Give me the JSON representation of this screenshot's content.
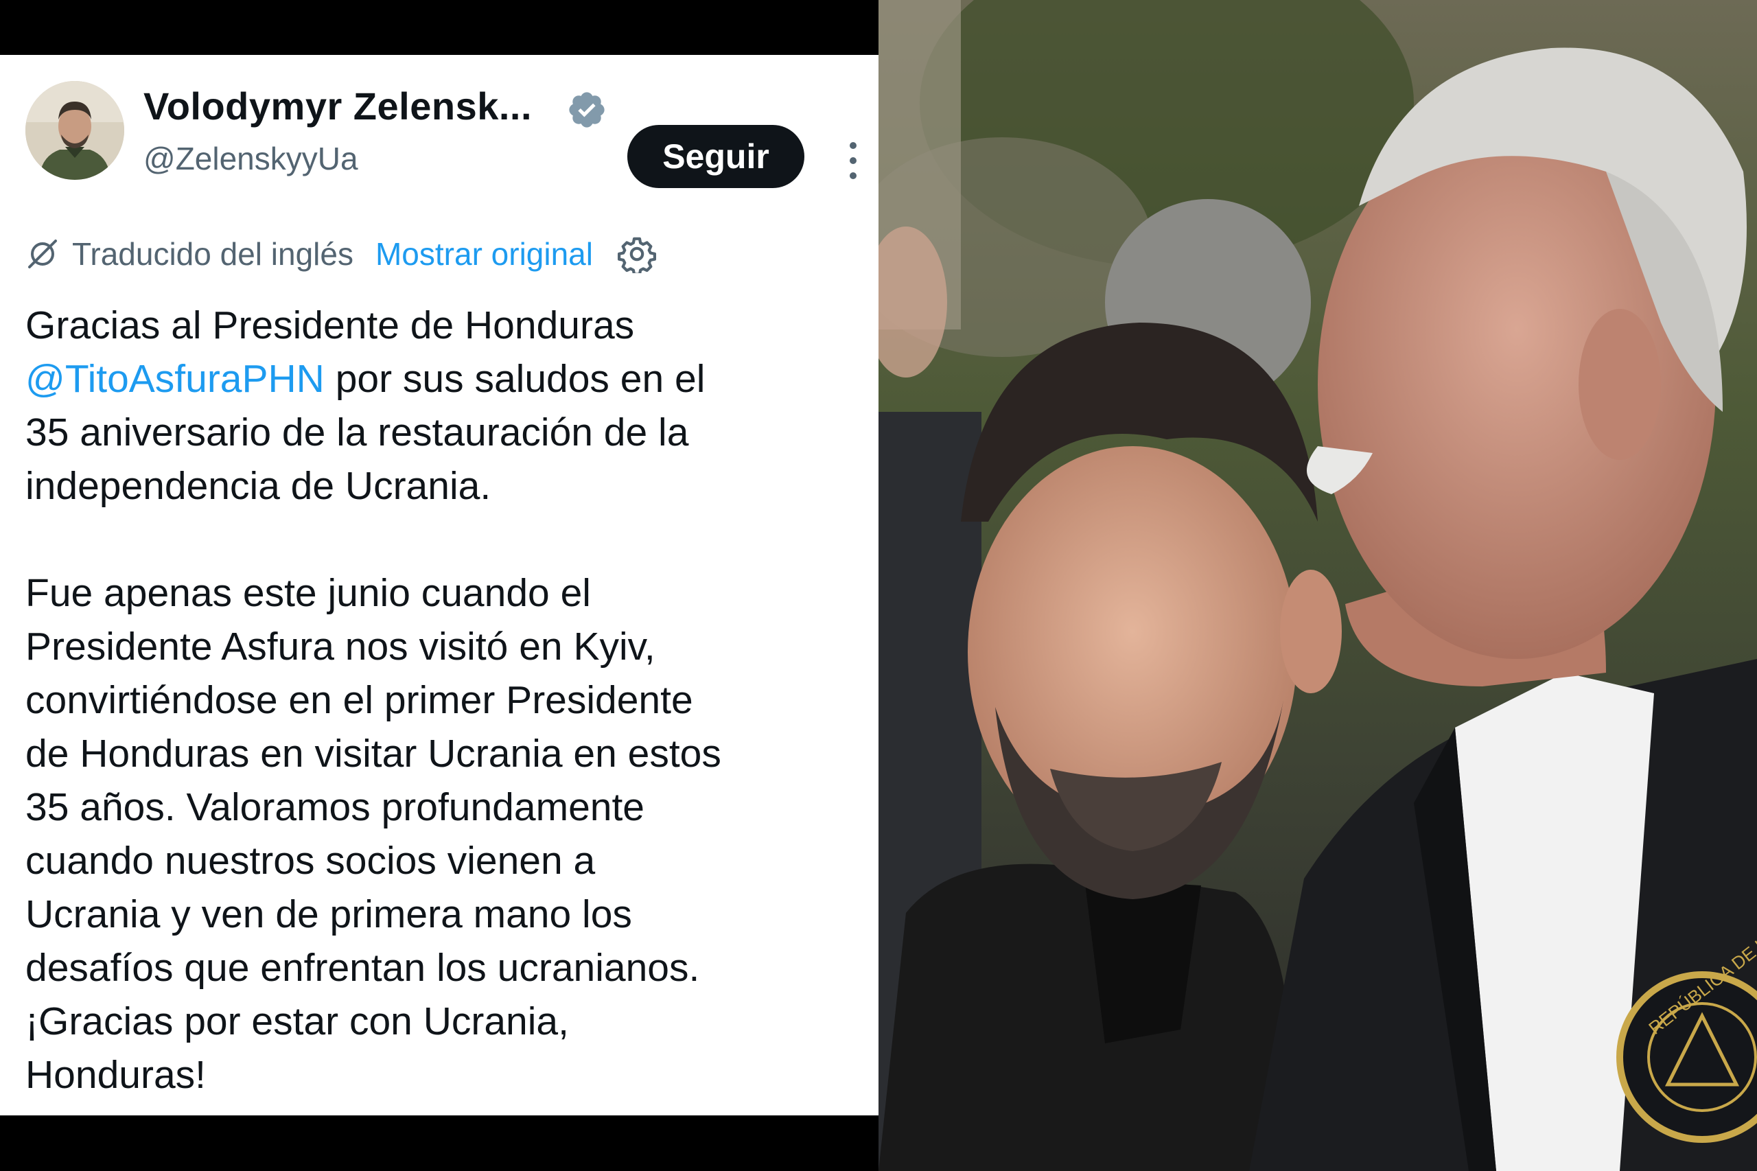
{
  "tweet": {
    "author": {
      "display_name": "Volodymyr Zelensk...",
      "handle": "@ZelenskyyUa",
      "verified": true
    },
    "follow_label": "Seguir",
    "translation": {
      "label": "Traducido del inglés",
      "show_original": "Mostrar original"
    },
    "body": {
      "para1_before": "Gracias al Presidente de Honduras\n",
      "mention": "@TitoAsfuraPHN",
      "para1_after": " por sus saludos en el\n35 aniversario de la restauración de la\nindependencia de Ucrania.",
      "para2": "Fue apenas este junio cuando el\nPresidente Asfura nos visitó en Kyiv,\nconvirtiéndose en el primer Presidente\nde Honduras en visitar Ucrania en estos\n35 años. Valoramos profundamente\ncuando nuestros socios vienen a\nUcrania y ven de primera mano los\ndesafíos que enfrentan los ucranianos.\n¡Gracias por estar con Ucrania,\nHonduras!"
    }
  },
  "colors": {
    "text": "#0f1419",
    "muted": "#536471",
    "link": "#1d9bf0",
    "verified": "#829aab",
    "button_bg": "#0f1419"
  },
  "icons": {
    "verified": "verified-badge-icon",
    "more": "more-vertical-icon",
    "translate": "translate-icon",
    "settings": "gear-icon"
  },
  "photo": {
    "emblem_text": "REPÚBLICA DE H"
  }
}
